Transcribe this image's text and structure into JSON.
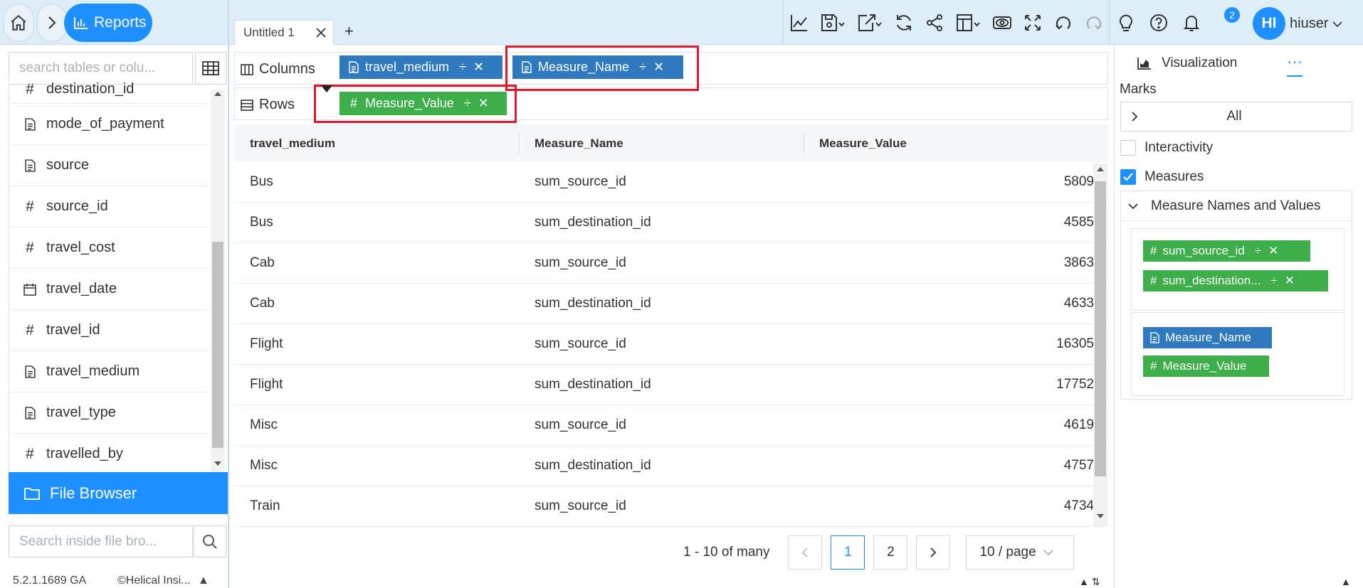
{
  "header": {
    "breadcrumb_label": "Reports",
    "doc_tab_title": "Untitled 1",
    "add_tab": "+",
    "notification_count": "2",
    "avatar_initials": "HI",
    "username": "hiuser"
  },
  "toolbar_icons": [
    "line-chart-icon",
    "save-icon",
    "export-icon",
    "refresh-icon",
    "share-icon",
    "layout-icon",
    "preview-icon",
    "fullscreen-icon",
    "undo-icon",
    "redo-icon",
    "lightbulb-icon",
    "help-icon",
    "bell-icon"
  ],
  "left_panel": {
    "search_placeholder": "search tables or colu...",
    "fields": [
      {
        "name": "destination_id",
        "type": "number"
      },
      {
        "name": "mode_of_payment",
        "type": "text"
      },
      {
        "name": "source",
        "type": "text"
      },
      {
        "name": "source_id",
        "type": "number"
      },
      {
        "name": "travel_cost",
        "type": "number"
      },
      {
        "name": "travel_date",
        "type": "date"
      },
      {
        "name": "travel_id",
        "type": "number"
      },
      {
        "name": "travel_medium",
        "type": "text"
      },
      {
        "name": "travel_type",
        "type": "text"
      },
      {
        "name": "travelled_by",
        "type": "number"
      }
    ],
    "file_browser_label": "File Browser",
    "file_search_placeholder": "Search inside file bro...",
    "version": "5.2.1.1689 GA",
    "company": "©Helical Insi..."
  },
  "shelves": {
    "columns_label": "Columns",
    "rows_label": "Rows",
    "columns_pills": [
      {
        "label": "travel_medium",
        "kind": "text",
        "color": "#2f79bf"
      },
      {
        "label": "Measure_Name",
        "kind": "text",
        "color": "#2f79bf"
      }
    ],
    "rows_pills": [
      {
        "label": "Measure_Value",
        "kind": "number",
        "color": "#3eae4b"
      }
    ]
  },
  "table": {
    "headers": [
      "travel_medium",
      "Measure_Name",
      "Measure_Value"
    ],
    "rows": [
      [
        "Bus",
        "sum_source_id",
        "5809"
      ],
      [
        "Bus",
        "sum_destination_id",
        "4585"
      ],
      [
        "Cab",
        "sum_source_id",
        "3863"
      ],
      [
        "Cab",
        "sum_destination_id",
        "4633"
      ],
      [
        "Flight",
        "sum_source_id",
        "16305"
      ],
      [
        "Flight",
        "sum_destination_id",
        "17752"
      ],
      [
        "Misc",
        "sum_source_id",
        "4619"
      ],
      [
        "Misc",
        "sum_destination_id",
        "4757"
      ],
      [
        "Train",
        "sum_source_id",
        "4734"
      ]
    ]
  },
  "pagination": {
    "summary": "1 - 10 of many",
    "pages": [
      "1",
      "2"
    ],
    "current_page": "1",
    "page_size": "10 / page"
  },
  "right_panel": {
    "visualization_tab": "Visualization",
    "more_tab": "···",
    "marks_label": "Marks",
    "marks_value": "All",
    "interactivity_label": "Interactivity",
    "interactivity_checked": false,
    "measures_label": "Measures",
    "measures_checked": true,
    "measure_names_values_label": "Measure Names and Values",
    "measure_pills": [
      "sum_source_id",
      "sum_destination..."
    ],
    "name_value_pills": [
      "Measure_Name",
      "Measure_Value"
    ]
  },
  "colors": {
    "accent": "#1e90ff",
    "text_pill": "#2f79bf",
    "number_pill": "#3eae4b",
    "highlight": "#e0182d",
    "topbar_bg": "#ddeef9"
  }
}
